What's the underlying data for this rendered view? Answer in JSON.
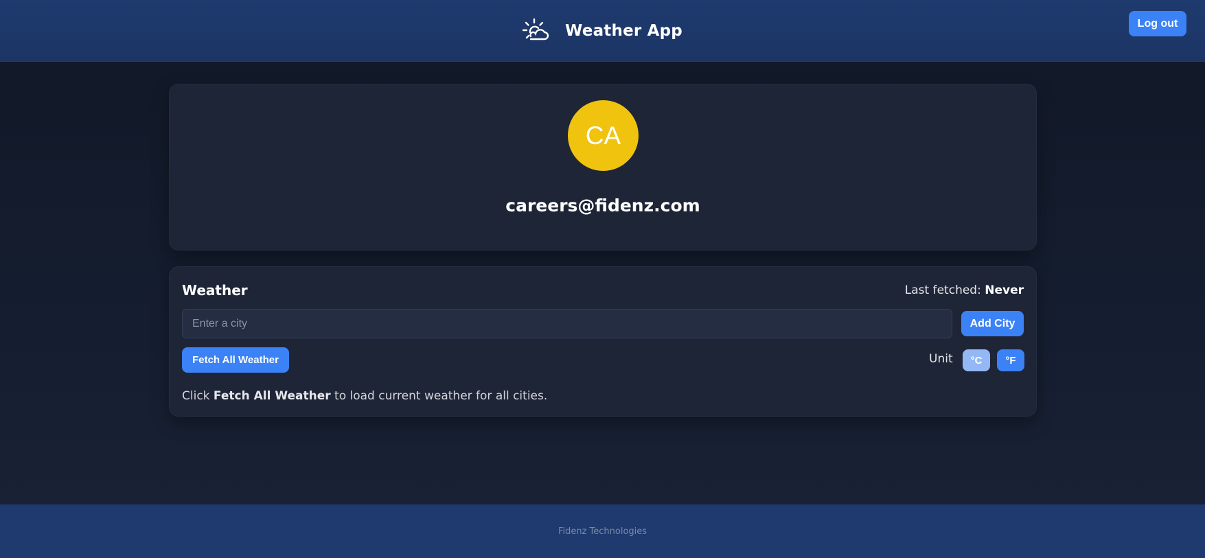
{
  "header": {
    "title": "Weather App",
    "logo_icon": "sun-cloud-icon",
    "logout_label": "Log out"
  },
  "profile": {
    "initials": "CA",
    "email": "careers@fidenz.com",
    "avatar_color": "#f0c30f"
  },
  "weather": {
    "title": "Weather",
    "last_fetched_label": "Last fetched:",
    "last_fetched_value": "Never",
    "city_input_value": "",
    "city_input_placeholder": "Enter a city",
    "add_city_label": "Add City",
    "fetch_all_label": "Fetch All Weather",
    "unit_label": "Unit",
    "unit_options": [
      "°C",
      "°F"
    ],
    "selected_unit": "°C",
    "hint_prefix": "Click",
    "hint_bold": "Fetch All Weather",
    "hint_suffix": "to load current weather for all cities."
  },
  "footer": {
    "text": "Fidenz Technologies"
  },
  "colors": {
    "accent": "#3b82f6",
    "header_bg": "#1e3a6e",
    "page_bg": "#111827",
    "card_bg": "#1e2537"
  }
}
